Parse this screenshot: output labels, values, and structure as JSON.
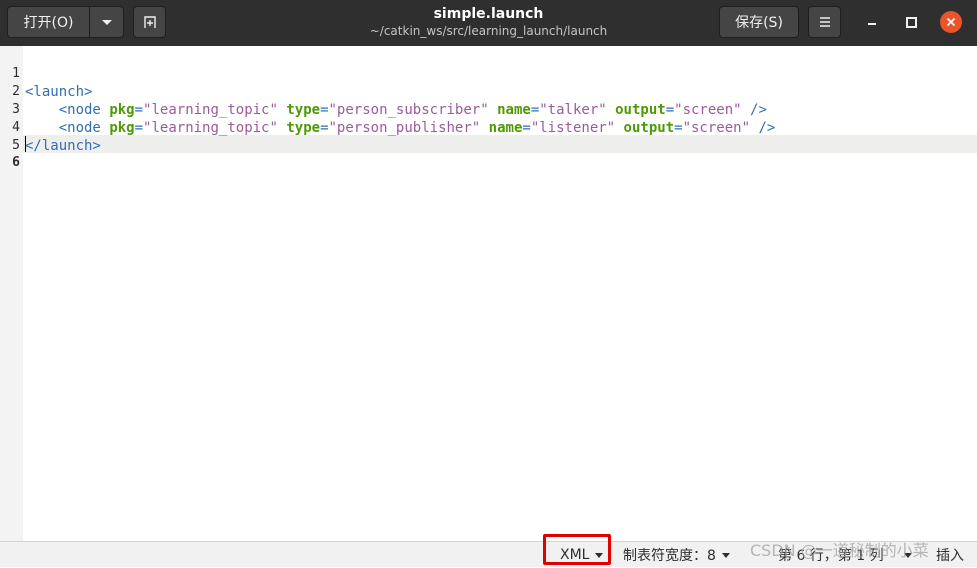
{
  "header": {
    "open_label": "打开(O)",
    "title": "simple.launch",
    "subtitle": "~/catkin_ws/src/learning_launch/launch",
    "save_label": "保存(S)",
    "close_color": "#e9542a"
  },
  "editor": {
    "line_numbers": [
      "1",
      "2",
      "3",
      "4",
      "5",
      "6"
    ],
    "current_line": "6",
    "lines": {
      "l1": {
        "tag_open": "<launch>"
      },
      "l2": {
        "tag": "<node",
        "a1": "pkg",
        "v1": "\"learning_topic\"",
        "a2": "type",
        "v2": "\"person_subscriber\"",
        "a3": "name",
        "v3": "\"talker\"",
        "a4": "output",
        "v4": "\"screen\"",
        "eq": "=",
        "close": "/>"
      },
      "l3": {
        "tag": "<node",
        "a1": "pkg",
        "v1": "\"learning_topic\"",
        "a2": "type",
        "v2": "\"person_publisher\"",
        "a3": "name",
        "v3": "\"listener\"",
        "a4": "output",
        "v4": "\"screen\"",
        "eq": "=",
        "close": "/>"
      },
      "l4": {
        "tag_close": "</launch>"
      }
    }
  },
  "statusbar": {
    "language": "XML",
    "tab_width": "制表符宽度：8",
    "position": "第 6 行，第 1 列",
    "mode": "插入"
  },
  "watermark": "CSDN @一道秘制的小菜",
  "colors": {
    "tag": "#2f6fb4",
    "attribute": "#4e9a06",
    "string": "#9b5a9b",
    "highlight_box": "#e00000"
  }
}
